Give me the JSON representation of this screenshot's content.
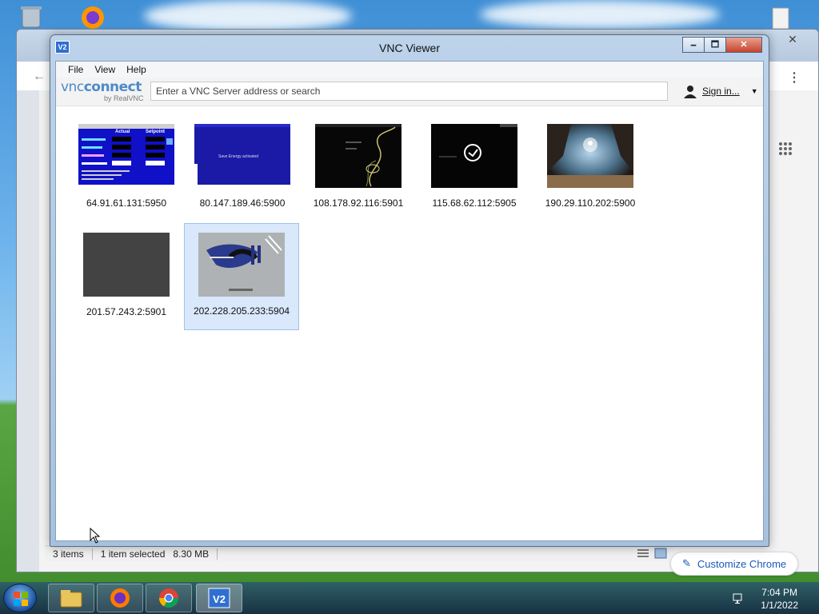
{
  "window": {
    "title": "VNC Viewer",
    "minimize": "🗕",
    "maximize": "🗖",
    "close": "✕"
  },
  "menu": [
    "File",
    "View",
    "Help"
  ],
  "brand": {
    "name_a": "vnc",
    "name_b": "connect",
    "sub": "by RealVNC"
  },
  "search": {
    "placeholder": "Enter a VNC Server address or search"
  },
  "account": {
    "sign_in": "Sign in..."
  },
  "servers": [
    {
      "address": "64.91.61.131:5950",
      "selected": false
    },
    {
      "address": "80.147.189.46:5900",
      "selected": false
    },
    {
      "address": "108.178.92.116:5901",
      "selected": false
    },
    {
      "address": "115.68.62.112:5905",
      "selected": false
    },
    {
      "address": "190.29.110.202:5900",
      "selected": false
    },
    {
      "address": "201.57.243.2:5901",
      "selected": false
    },
    {
      "address": "202.228.205.233:5904",
      "selected": true
    }
  ],
  "thumb_text": {
    "actual": "Actual",
    "setpoint": "Setpoint",
    "save_energy": "Save Energy activated"
  },
  "explorer": {
    "items": "3 items",
    "selected": "1 item selected",
    "size": "8.30 MB"
  },
  "chrome": {
    "customize": "Customize Chrome",
    "close": "✕"
  },
  "taskbar": {
    "time": "7:04 PM",
    "date": "1/1/2022"
  },
  "colors": {
    "accent": "#4e8ac9",
    "selection": "#d9e8fb",
    "close_red": "#c7442c"
  }
}
